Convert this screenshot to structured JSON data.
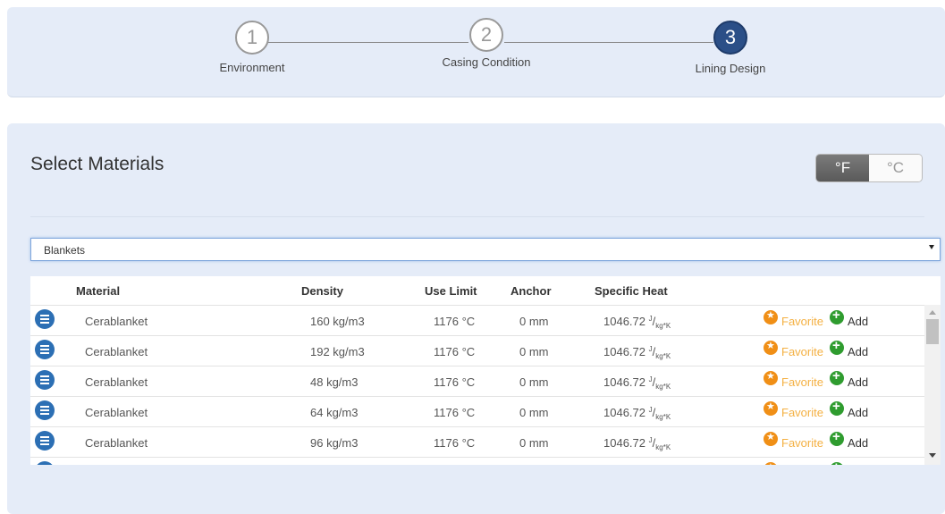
{
  "stepper": {
    "steps": [
      {
        "number": "1",
        "label": "Environment"
      },
      {
        "number": "2",
        "label": "Casing Condition"
      },
      {
        "number": "3",
        "label": "Lining Design"
      }
    ]
  },
  "main": {
    "title": "Select Materials",
    "units": {
      "fahrenheit": "°F",
      "celsius": "°C",
      "selected": "°F"
    },
    "category_select": {
      "value": "Blankets"
    },
    "table": {
      "headers": {
        "material": "Material",
        "density": "Density",
        "use_limit": "Use Limit",
        "anchor": "Anchor",
        "specific_heat": "Specific Heat"
      },
      "rows": [
        {
          "material": "Cerablanket",
          "density": "160 kg/m3",
          "use_limit": "1176 °C",
          "anchor": "0 mm",
          "specific_heat": "1046.72",
          "sh_num": "J",
          "sh_den": "kg*K",
          "favorite": "Favorite",
          "add": "Add"
        },
        {
          "material": "Cerablanket",
          "density": "192 kg/m3",
          "use_limit": "1176 °C",
          "anchor": "0 mm",
          "specific_heat": "1046.72",
          "sh_num": "J",
          "sh_den": "kg*K",
          "favorite": "Favorite",
          "add": "Add"
        },
        {
          "material": "Cerablanket",
          "density": "48 kg/m3",
          "use_limit": "1176 °C",
          "anchor": "0 mm",
          "specific_heat": "1046.72",
          "sh_num": "J",
          "sh_den": "kg*K",
          "favorite": "Favorite",
          "add": "Add"
        },
        {
          "material": "Cerablanket",
          "density": "64 kg/m3",
          "use_limit": "1176 °C",
          "anchor": "0 mm",
          "specific_heat": "1046.72",
          "sh_num": "J",
          "sh_den": "kg*K",
          "favorite": "Favorite",
          "add": "Add"
        },
        {
          "material": "Cerablanket",
          "density": "96 kg/m3",
          "use_limit": "1176 °C",
          "anchor": "0 mm",
          "specific_heat": "1046.72",
          "sh_num": "J",
          "sh_den": "kg*K",
          "favorite": "Favorite",
          "add": "Add"
        }
      ]
    }
  },
  "colors": {
    "active_step": "#2b4f87",
    "info_icon": "#2c6fb4",
    "favorite": "#f08f16",
    "add": "#2f9c2f"
  }
}
